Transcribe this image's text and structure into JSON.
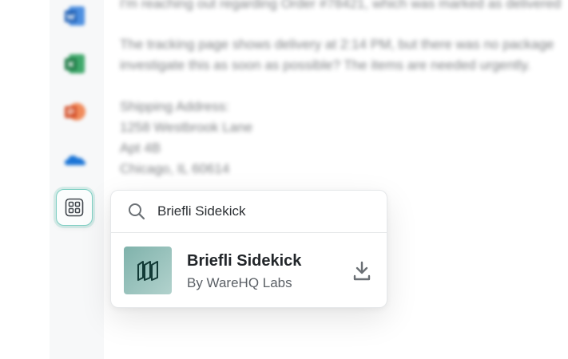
{
  "email": {
    "lines": [
      "I'm reaching out regarding Order #78421, which was marked as delivered",
      "The tracking page shows delivery at 2:14 PM, but there was no package",
      "investigate this as soon as possible? The items are needed urgently.",
      "Shipping Address:",
      "1258 Westbrook Lane",
      "Apt 4B",
      "Chicago, IL 60614"
    ]
  },
  "rail": {
    "icons": [
      "word-icon",
      "excel-icon",
      "powerpoint-icon",
      "onedrive-icon",
      "apps-grid-icon"
    ],
    "colors": {
      "word": "#1e5fb4",
      "excel": "#1d7a45",
      "powerpoint": "#d4532d",
      "onedrive": "#1a74d6",
      "accent": "#7fcfc3"
    }
  },
  "search": {
    "value": "Briefli Sidekick"
  },
  "result": {
    "name": "Briefli Sidekick",
    "publisher": "By WareHQ Labs",
    "logo_icon": "briefli-logo-icon",
    "action_icon": "download-icon"
  }
}
